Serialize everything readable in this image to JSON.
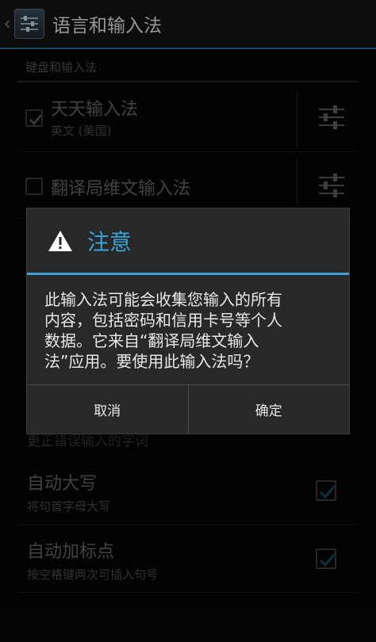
{
  "actionbar": {
    "title": "语言和输入法",
    "up_icon": "chevron-left-icon",
    "app_icon": "settings-sliders-icon"
  },
  "section": {
    "header": "键盘和输入法"
  },
  "keyboards": [
    {
      "title": "天天输入法",
      "subtitle": "英文 (美国)",
      "checked": true
    },
    {
      "title": "翻译局维文输入法",
      "subtitle": "",
      "checked": false
    }
  ],
  "partial_subtitle": "更正错误输入的字词",
  "prefs": [
    {
      "title": "自动大写",
      "subtitle": "将句首字母大写",
      "checked": true
    },
    {
      "title": "自动加标点",
      "subtitle": "按空格键两次可插入句号",
      "checked": true
    }
  ],
  "dialog": {
    "title": "注意",
    "icon": "warning-icon",
    "message_lines": [
      "此输入法可能会收集您输入的所有",
      "内容，包括密码和信用卡号等个人",
      "数据。它来自“翻译局维文输入",
      "法”应用。要使用此输入法吗？"
    ],
    "cancel": "取消",
    "ok": "确定"
  },
  "colors": {
    "accent": "#38a3d6",
    "divider": "#2b6f8f"
  }
}
